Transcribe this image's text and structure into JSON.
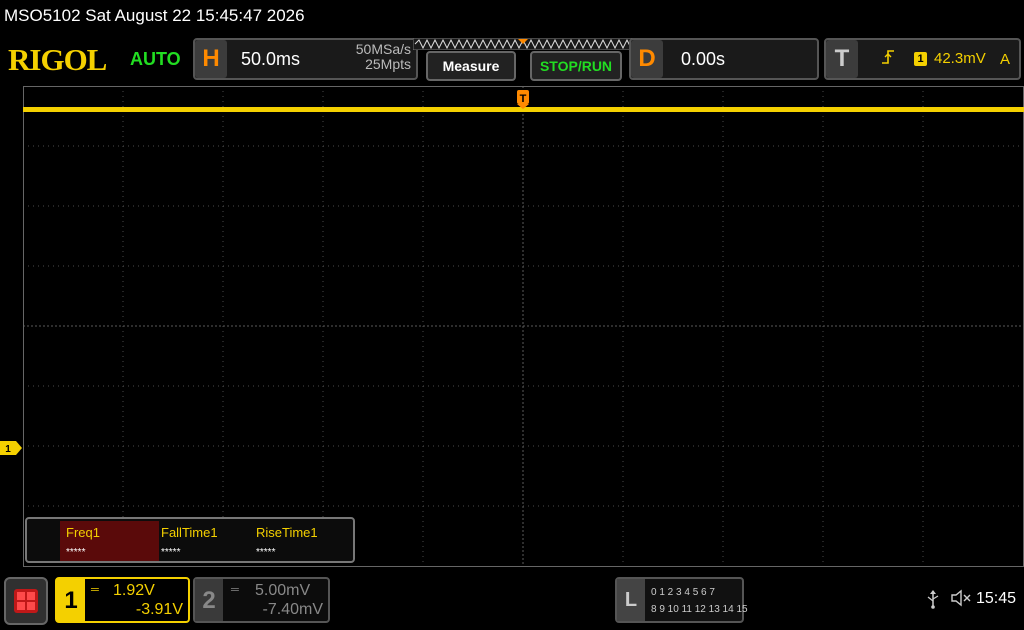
{
  "title_bar": {
    "text": "MSO5102  Sat August 22 15:45:47 2026"
  },
  "header": {
    "logo": "RIGOL",
    "mode": "AUTO",
    "horizontal": {
      "letter": "H",
      "timebase": "50.0ms",
      "sample_rate": "50MSa/s",
      "memory_depth": "25Mpts"
    },
    "measure_button": "Measure",
    "stop_run_button": "STOP/RUN",
    "delay": {
      "letter": "D",
      "value": "0.00s"
    },
    "trigger": {
      "letter": "T",
      "edge_icon": "rising-edge-icon",
      "source": "1",
      "level": "42.3mV",
      "coupling": "A"
    }
  },
  "waveform": {
    "channel_marker": "1",
    "trigger_marker": "T",
    "colors": {
      "ch1": "#f4d000",
      "grid": "#4a4a4a",
      "accent_orange": "#ff8a00",
      "active_green": "#22dd22"
    }
  },
  "measurements": [
    {
      "name": "Freq1",
      "value": "*****",
      "selected": true
    },
    {
      "name": "FallTime1",
      "value": "*****",
      "selected": false
    },
    {
      "name": "RiseTime1",
      "value": "*****",
      "selected": false
    }
  ],
  "footer": {
    "menu_icon": "grid-menu-icon",
    "ch1": {
      "number": "1",
      "coupling_icon": "dc-coupling-icon",
      "scale": "1.92V",
      "offset": "-3.91V"
    },
    "ch2": {
      "number": "2",
      "coupling_icon": "dc-coupling-icon",
      "scale": "5.00mV",
      "offset": "-7.40mV"
    },
    "logic": {
      "letter": "L",
      "row1": "0 1 2 3   4 5 6 7",
      "row2": "8  9 10 11  12 13 14 15"
    },
    "usb_icon": "usb-icon",
    "speaker_icon": "speaker-muted-icon",
    "time": "15:45"
  }
}
